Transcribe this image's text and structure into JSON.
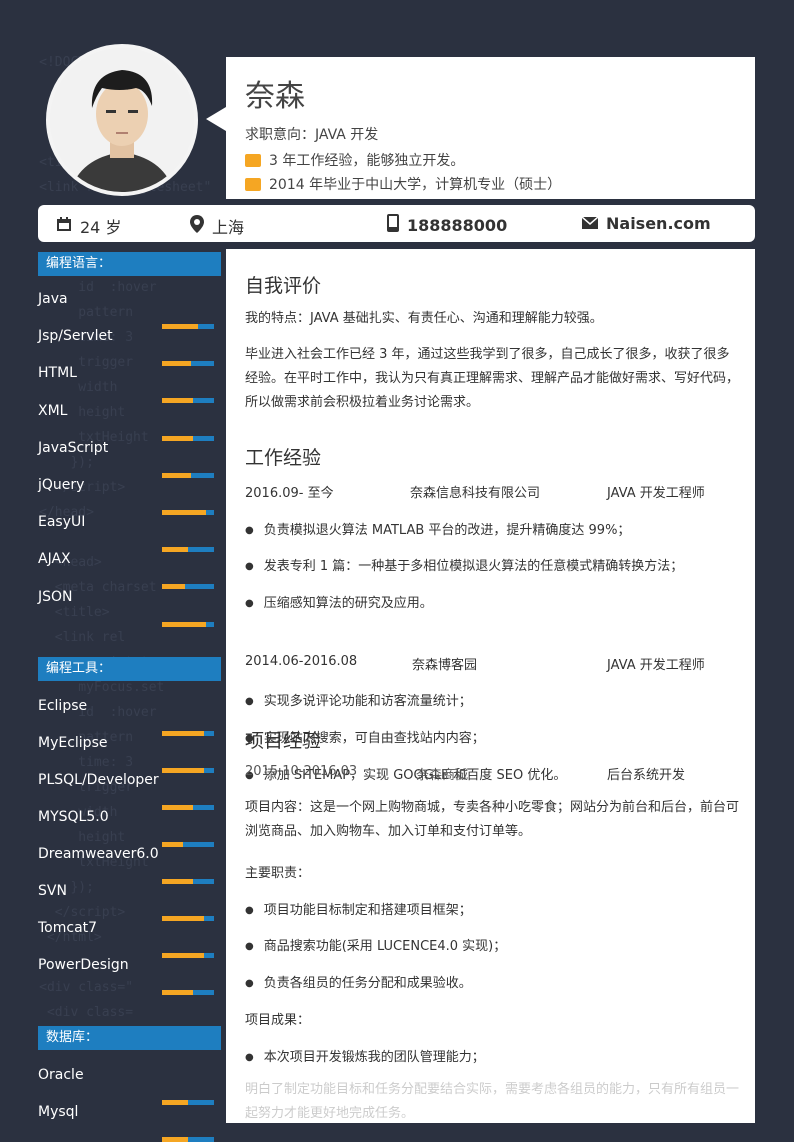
{
  "header": {
    "name": "奈森",
    "intent": "求职意向：JAVA 开发",
    "experience": "3 年工作经验，能够独立开发。",
    "education": "2014 年毕业于中山大学，计算机专业（硕士）"
  },
  "info": {
    "age": "24 岁",
    "city": "上海",
    "phone": "188888000",
    "site": "Naisen.com"
  },
  "sidebar": {
    "lang_title": "编程语言：",
    "languages": [
      {
        "label": "Java",
        "level": 0.7
      },
      {
        "label": "Jsp/Servlet",
        "level": 0.55
      },
      {
        "label": "HTML",
        "level": 0.6
      },
      {
        "label": "XML",
        "level": 0.6
      },
      {
        "label": "JavaScript",
        "level": 0.55
      },
      {
        "label": "jQuery",
        "level": 0.85
      },
      {
        "label": "EasyUI",
        "level": 0.5
      },
      {
        "label": "AJAX",
        "level": 0.45
      },
      {
        "label": "JSON",
        "level": 0.85
      }
    ],
    "tools_title": "编程工具：",
    "tools": [
      {
        "label": "Eclipse",
        "level": 0.8
      },
      {
        "label": "MyEclipse",
        "level": 0.8
      },
      {
        "label": "PLSQL/Developer",
        "level": 0.6
      },
      {
        "label": "MYSQL5.0",
        "level": 0.4
      },
      {
        "label": "Dreamweaver6.0",
        "level": 0.6
      },
      {
        "label": "SVN",
        "level": 0.8
      },
      {
        "label": "Tomcat7",
        "level": 0.8
      },
      {
        "label": "PowerDesign",
        "level": 0.6
      }
    ],
    "db_title": "数据库：",
    "dbs": [
      {
        "label": "Oracle",
        "level": 0.5
      },
      {
        "label": "Mysql",
        "level": 0.5
      }
    ]
  },
  "main": {
    "self_title": "自我评价",
    "self_p1": "我的特点：JAVA 基础扎实、有责任心、沟通和理解能力较强。",
    "self_p2": "毕业进入社会工作已经 3 年，通过这些我学到了很多，自己成长了很多，收获了很多经验。在平时工作中，我认为只有真正理解需求、理解产品才能做好需求、写好代码，所以做需求前会积极拉着业务讨论需求。",
    "work_title": "工作经验",
    "job1": {
      "date": "2016.09- 至今",
      "company": "奈森信息科技有限公司",
      "role": "JAVA 开发工程师"
    },
    "job1_items": [
      "负责模拟退火算法 MATLAB 平台的改进，提升精确度达 99%；",
      "发表专利 1 篇：一种基于多相位模拟退火算法的任意模式精确转换方法；",
      "压缩感知算法的研究及应用。"
    ],
    "job2": {
      "date": "2014.06-2016.08",
      "company": "奈森博客园",
      "role": "JAVA 开发工程师"
    },
    "job2_items": [
      "实现多说评论功能和访客流量统计；",
      "实现站内搜索，可自由查找站内内容；",
      "添加 SITEMAP，实现 GOOGLE 和百度 SEO 优化。"
    ],
    "proj_title": "项目经验",
    "proj": {
      "date": "2015.10-2016.03",
      "name": "奈森商城",
      "role": "后台系统开发"
    },
    "proj_content": "项目内容：这是一个网上购物商城，专卖各种小吃零食；网站分为前台和后台，前台可浏览商品、加入购物车、加入订单和支付订单等。",
    "duty_title": "主要职责：",
    "duties": [
      "项目功能目标制定和搭建项目框架；",
      "商品搜索功能(采用 LUCENCE4.0 实现)；",
      "负责各组员的任务分配和成果验收。"
    ],
    "result_title": "项目成果：",
    "results": [
      "本次项目开发锻炼我的团队管理能力；",
      "明白了制定功能目标和任务分配要结合实际，需要考虑各组员的能力，只有所有组员一起努力才能更好地完成任务。"
    ]
  },
  "colors": {
    "accent": "#f5a623",
    "blue": "#1e7ec0",
    "background": "#2b3140"
  }
}
